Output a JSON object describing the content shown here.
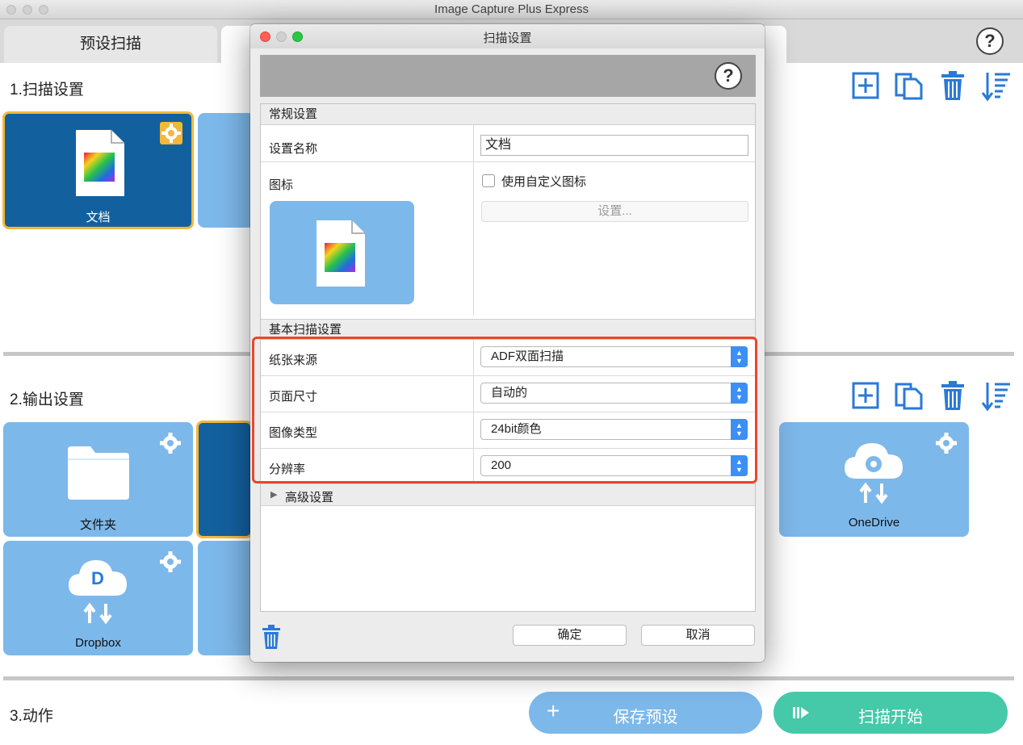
{
  "window": {
    "title": "Image Capture Plus Express"
  },
  "tabs": {
    "preset": "预设扫描"
  },
  "section1": {
    "title": "1.扫描设置",
    "tile_label": "文档"
  },
  "section2": {
    "title": "2.输出设置",
    "tiles": {
      "folder": "文件夹",
      "onedrive": "OneDrive",
      "dropbox": "Dropbox",
      "dropbox_letter": "D"
    }
  },
  "section3": {
    "title": "3.动作",
    "save_label": "保存预设",
    "scan_label": "扫描开始"
  },
  "dialog": {
    "title": "扫描设置",
    "general": {
      "header": "常规设置",
      "name_label": "设置名称",
      "name_value": "文档",
      "icon_label": "图标",
      "custom_icon_label": "使用自定义图标",
      "custom_icon_checked": false,
      "settings_button": "设置..."
    },
    "basic": {
      "header": "基本扫描设置",
      "paper_source_label": "纸张来源",
      "paper_source_value": "ADF双面扫描",
      "page_size_label": "页面尺寸",
      "page_size_value": "自动的",
      "image_type_label": "图像类型",
      "image_type_value": "24bit颜色",
      "resolution_label": "分辨率",
      "resolution_value": "200"
    },
    "advanced_label": "高级设置",
    "ok_button": "确定",
    "cancel_button": "取消"
  },
  "colors": {
    "accent_blue": "#3b8ff5",
    "tile_light": "#7db8ea",
    "tile_dark": "#13609f",
    "selection": "#f4b73a",
    "highlight": "#e8472c",
    "scan_green": "#45c9a8"
  }
}
